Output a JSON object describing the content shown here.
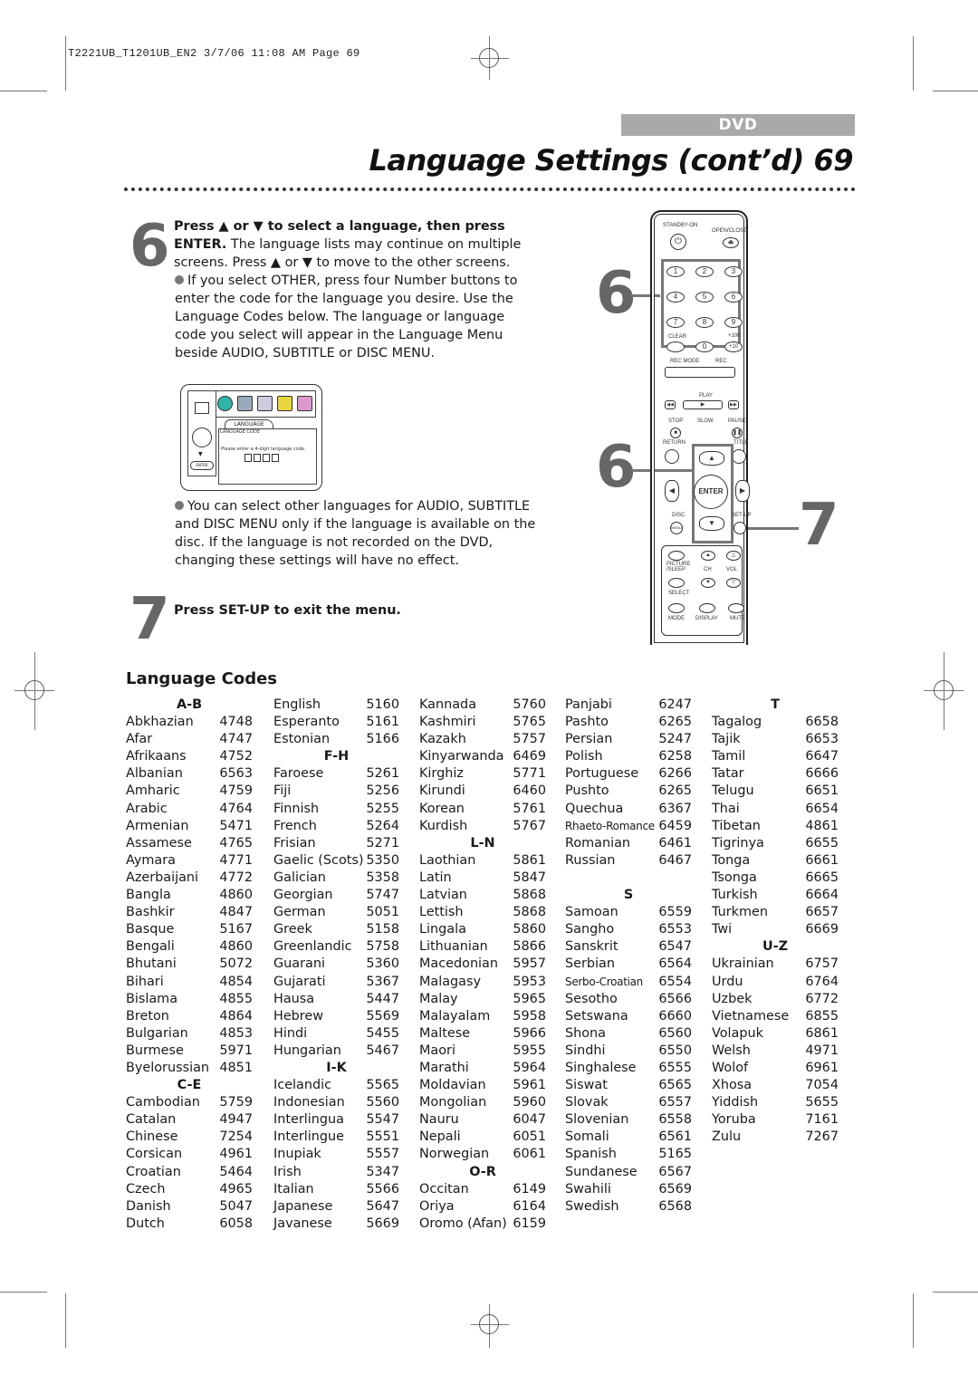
{
  "slug": "T2221UB_T1201UB_EN2  3/7/06  11:08 AM  Page 69",
  "header": {
    "badge": "DVD",
    "title": "Language Settings (cont’d)  69"
  },
  "step6": {
    "number": "6",
    "bold_lead": "Press ▲ or ▼ to select a language, then press ENTER.",
    "text": "The language lists may continue on multiple screens.  Press ▲ or ▼ to move to the other screens.",
    "bullet1": "If you select OTHER, press four Number buttons to enter the code for the language you desire.  Use the Language Codes below.  The language or language code you select will appear in the Language Menu beside AUDIO, SUBTITLE or DISC MENU.",
    "bullet2": "You can select other languages for AUDIO, SUBTITLE and DISC MENU only if the language is available on the disc.  If the language is not recorded on the DVD, changing these settings will have no effect."
  },
  "osd": {
    "tab": "LANGUAGE",
    "subtitle": "LANGUAGE CODE",
    "message": "Please enter a 4-digit language code.",
    "enter_label": "ENTER"
  },
  "step7": {
    "number": "7",
    "text": "Press SET-UP to exit the menu."
  },
  "remote": {
    "standby": "STANDBY-ON",
    "open_close": "OPEN/CLOSE",
    "digits": [
      "1",
      "2",
      "3",
      "4",
      "5",
      "6",
      "7",
      "8",
      "9"
    ],
    "clear": "CLEAR",
    "zero": "0",
    "plus100": "+100",
    "plus10": "+10",
    "rec_mode": "REC MODE",
    "rec": "REC",
    "play": "PLAY",
    "stop": "STOP",
    "slow": "SLOW",
    "pause": "PAUSE",
    "return": "RETURN",
    "title": "TITLE",
    "enter": "ENTER",
    "disc": "DISC",
    "menu": "MENU",
    "setup": "SET-UP",
    "picture_sleep": "PICTURE /SLEEP",
    "ch": "CH",
    "vol": "VOL",
    "select": "SELECT",
    "mode": "MODE",
    "display": "DISPLAY",
    "mute": "MUTE",
    "callouts": [
      "6",
      "6",
      "7"
    ]
  },
  "language_codes": {
    "title": "Language Codes",
    "columns": [
      [
        {
          "header": "A-B"
        },
        {
          "name": "Abkhazian",
          "code": "4748"
        },
        {
          "name": "Afar",
          "code": "4747"
        },
        {
          "name": "Afrikaans",
          "code": "4752"
        },
        {
          "name": "Albanian",
          "code": "6563"
        },
        {
          "name": "Amharic",
          "code": "4759"
        },
        {
          "name": "Arabic",
          "code": "4764"
        },
        {
          "name": "Armenian",
          "code": "5471"
        },
        {
          "name": "Assamese",
          "code": "4765"
        },
        {
          "name": "Aymara",
          "code": "4771"
        },
        {
          "name": "Azerbaijani",
          "code": "4772"
        },
        {
          "name": "Bangla",
          "code": "4860"
        },
        {
          "name": "Bashkir",
          "code": "4847"
        },
        {
          "name": "Basque",
          "code": "5167"
        },
        {
          "name": "Bengali",
          "code": "4860"
        },
        {
          "name": "Bhutani",
          "code": "5072"
        },
        {
          "name": "Bihari",
          "code": "4854"
        },
        {
          "name": "Bislama",
          "code": "4855"
        },
        {
          "name": "Breton",
          "code": "4864"
        },
        {
          "name": "Bulgarian",
          "code": "4853"
        },
        {
          "name": "Burmese",
          "code": "5971"
        },
        {
          "name": "Byelorussian",
          "code": "4851"
        },
        {
          "header": "C-E"
        },
        {
          "name": "Cambodian",
          "code": "5759"
        },
        {
          "name": "Catalan",
          "code": "4947"
        },
        {
          "name": "Chinese",
          "code": "7254"
        },
        {
          "name": "Corsican",
          "code": "4961"
        },
        {
          "name": "Croatian",
          "code": "5464"
        },
        {
          "name": "Czech",
          "code": "4965"
        },
        {
          "name": "Danish",
          "code": "5047"
        },
        {
          "name": "Dutch",
          "code": "6058"
        }
      ],
      [
        {
          "name": "English",
          "code": "5160"
        },
        {
          "name": "Esperanto",
          "code": "5161"
        },
        {
          "name": "Estonian",
          "code": "5166"
        },
        {
          "header": "F-H"
        },
        {
          "name": "Faroese",
          "code": "5261"
        },
        {
          "name": "Fiji",
          "code": "5256"
        },
        {
          "name": "Finnish",
          "code": "5255"
        },
        {
          "name": "French",
          "code": "5264"
        },
        {
          "name": "Frisian",
          "code": "5271"
        },
        {
          "name": "Gaelic (Scots)",
          "code": "5350"
        },
        {
          "name": "Galician",
          "code": "5358"
        },
        {
          "name": "Georgian",
          "code": "5747"
        },
        {
          "name": "German",
          "code": "5051"
        },
        {
          "name": "Greek",
          "code": "5158"
        },
        {
          "name": "Greenlandic",
          "code": "5758"
        },
        {
          "name": "Guarani",
          "code": "5360"
        },
        {
          "name": "Gujarati",
          "code": "5367"
        },
        {
          "name": "Hausa",
          "code": "5447"
        },
        {
          "name": "Hebrew",
          "code": "5569"
        },
        {
          "name": "Hindi",
          "code": "5455"
        },
        {
          "name": "Hungarian",
          "code": "5467"
        },
        {
          "header": "I-K"
        },
        {
          "name": "Icelandic",
          "code": "5565"
        },
        {
          "name": "Indonesian",
          "code": "5560"
        },
        {
          "name": "Interlingua",
          "code": "5547"
        },
        {
          "name": "Interlingue",
          "code": "5551"
        },
        {
          "name": "Inupiak",
          "code": "5557"
        },
        {
          "name": "Irish",
          "code": "5347"
        },
        {
          "name": "Italian",
          "code": "5566"
        },
        {
          "name": "Japanese",
          "code": "5647"
        },
        {
          "name": "Javanese",
          "code": "5669"
        }
      ],
      [
        {
          "name": "Kannada",
          "code": "5760"
        },
        {
          "name": "Kashmiri",
          "code": "5765"
        },
        {
          "name": "Kazakh",
          "code": "5757"
        },
        {
          "name": "Kinyarwanda",
          "code": "6469"
        },
        {
          "name": "Kirghiz",
          "code": "5771"
        },
        {
          "name": "Kirundi",
          "code": "6460"
        },
        {
          "name": "Korean",
          "code": "5761"
        },
        {
          "name": "Kurdish",
          "code": "5767"
        },
        {
          "header": "L-N"
        },
        {
          "name": "Laothian",
          "code": "5861"
        },
        {
          "name": "Latin",
          "code": "5847"
        },
        {
          "name": "Latvian",
          "code": "5868"
        },
        {
          "name": "Lettish",
          "code": "5868"
        },
        {
          "name": "Lingala",
          "code": "5860"
        },
        {
          "name": "Lithuanian",
          "code": "5866"
        },
        {
          "name": "Macedonian",
          "code": "5957"
        },
        {
          "name": "Malagasy",
          "code": "5953"
        },
        {
          "name": "Malay",
          "code": "5965"
        },
        {
          "name": "Malayalam",
          "code": "5958"
        },
        {
          "name": "Maltese",
          "code": "5966"
        },
        {
          "name": "Maori",
          "code": "5955"
        },
        {
          "name": "Marathi",
          "code": "5964"
        },
        {
          "name": "Moldavian",
          "code": "5961"
        },
        {
          "name": "Mongolian",
          "code": "5960"
        },
        {
          "name": "Nauru",
          "code": "6047"
        },
        {
          "name": "Nepali",
          "code": "6051"
        },
        {
          "name": "Norwegian",
          "code": "6061"
        },
        {
          "header": "O-R"
        },
        {
          "name": "Occitan",
          "code": "6149"
        },
        {
          "name": "Oriya",
          "code": "6164"
        },
        {
          "name": "Oromo (Afan)",
          "code": "6159"
        }
      ],
      [
        {
          "name": "Panjabi",
          "code": "6247"
        },
        {
          "name": "Pashto",
          "code": "6265"
        },
        {
          "name": "Persian",
          "code": "5247"
        },
        {
          "name": "Polish",
          "code": "6258"
        },
        {
          "name": "Portuguese",
          "code": "6266"
        },
        {
          "name": "Pushto",
          "code": "6265"
        },
        {
          "name": "Quechua",
          "code": "6367"
        },
        {
          "name": "Rhaeto-Romance",
          "code": "6459",
          "small": true
        },
        {
          "name": "Romanian",
          "code": "6461"
        },
        {
          "name": "Russian",
          "code": "6467"
        },
        {
          "blank": true
        },
        {
          "header": "S"
        },
        {
          "name": "Samoan",
          "code": "6559"
        },
        {
          "name": "Sangho",
          "code": "6553"
        },
        {
          "name": "Sanskrit",
          "code": "6547"
        },
        {
          "name": "Serbian",
          "code": "6564"
        },
        {
          "name": "Serbo-Croatian",
          "code": "6554",
          "small": true
        },
        {
          "name": "Sesotho",
          "code": "6566"
        },
        {
          "name": "Setswana",
          "code": "6660"
        },
        {
          "name": "Shona",
          "code": "6560"
        },
        {
          "name": "Sindhi",
          "code": "6550"
        },
        {
          "name": "Singhalese",
          "code": "6555"
        },
        {
          "name": "Siswat",
          "code": "6565"
        },
        {
          "name": "Slovak",
          "code": "6557"
        },
        {
          "name": "Slovenian",
          "code": "6558"
        },
        {
          "name": "Somali",
          "code": "6561"
        },
        {
          "name": "Spanish",
          "code": "5165"
        },
        {
          "name": "Sundanese",
          "code": "6567"
        },
        {
          "name": "Swahili",
          "code": "6569"
        },
        {
          "name": "Swedish",
          "code": "6568"
        }
      ],
      [
        {
          "header": "T"
        },
        {
          "name": "Tagalog",
          "code": "6658"
        },
        {
          "name": "Tajik",
          "code": "6653"
        },
        {
          "name": "Tamil",
          "code": "6647"
        },
        {
          "name": "Tatar",
          "code": "6666"
        },
        {
          "name": "Telugu",
          "code": "6651"
        },
        {
          "name": "Thai",
          "code": "6654"
        },
        {
          "name": "Tibetan",
          "code": "4861"
        },
        {
          "name": "Tigrinya",
          "code": "6655"
        },
        {
          "name": "Tonga",
          "code": "6661"
        },
        {
          "name": "Tsonga",
          "code": "6665"
        },
        {
          "name": "Turkish",
          "code": "6664"
        },
        {
          "name": "Turkmen",
          "code": "6657"
        },
        {
          "name": "Twi",
          "code": "6669"
        },
        {
          "header": "U-Z"
        },
        {
          "name": "Ukrainian",
          "code": "6757"
        },
        {
          "name": "Urdu",
          "code": "6764"
        },
        {
          "name": "Uzbek",
          "code": "6772"
        },
        {
          "name": "Vietnamese",
          "code": "6855"
        },
        {
          "name": "Volapuk",
          "code": "6861"
        },
        {
          "name": "Welsh",
          "code": "4971"
        },
        {
          "name": "Wolof",
          "code": "6961"
        },
        {
          "name": "Xhosa",
          "code": "7054"
        },
        {
          "name": "Yiddish",
          "code": "5655"
        },
        {
          "name": "Yoruba",
          "code": "7161"
        },
        {
          "name": "Zulu",
          "code": "7267"
        }
      ]
    ]
  }
}
